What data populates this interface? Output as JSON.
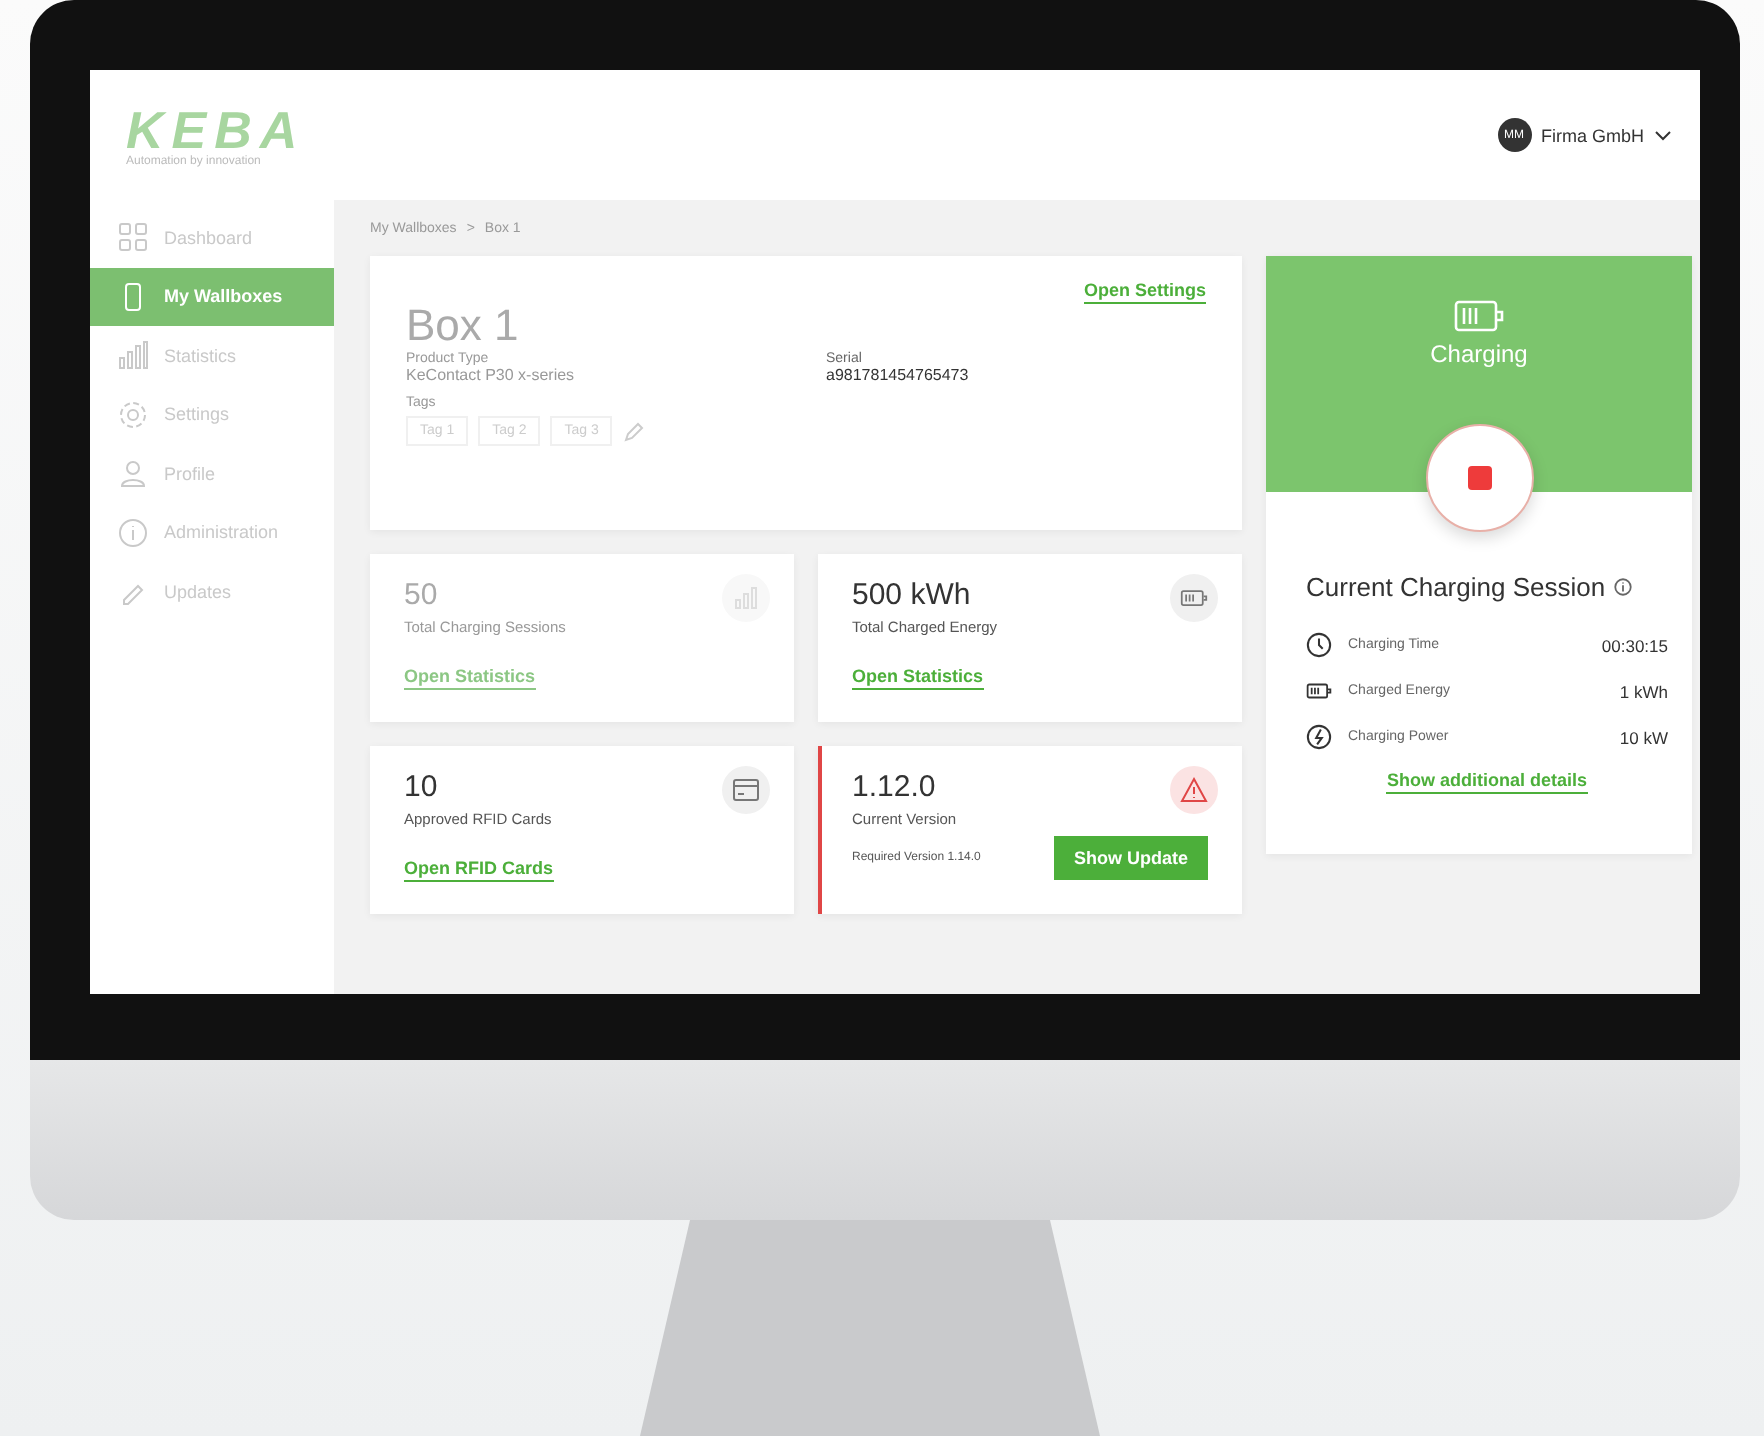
{
  "logo": {
    "name": "KEBA",
    "tagline": "Automation by innovation"
  },
  "user": {
    "initials": "MM",
    "name": "Firma GmbH"
  },
  "sidebar": {
    "items": [
      {
        "label": "Dashboard",
        "selected": false
      },
      {
        "label": "My Wallboxes",
        "selected": true
      },
      {
        "label": "Statistics",
        "selected": false
      },
      {
        "label": "Settings",
        "selected": false
      },
      {
        "label": "Profile",
        "selected": false
      },
      {
        "label": "Administration",
        "selected": false
      },
      {
        "label": "Updates",
        "selected": false
      }
    ]
  },
  "breadcrumb": {
    "items": [
      "My Wallboxes",
      "Box 1"
    ],
    "separator": ">"
  },
  "box": {
    "title": "Box 1",
    "link": "Open Settings",
    "product_type_label": "Product Type",
    "product_type": "KeContact P30 x-series",
    "serial_label": "Serial",
    "serial": "a981781454765473",
    "tags_label": "Tags",
    "tags": [
      "Tag 1",
      "Tag 2",
      "Tag 3"
    ]
  },
  "stat_cards": [
    {
      "kind": "chart",
      "value": "50",
      "label": "Total Charging Sessions",
      "link": "Open Statistics"
    },
    {
      "kind": "battery",
      "value": "500 kWh",
      "label": "Total Charged Energy",
      "link": "Open Statistics"
    },
    {
      "kind": "card",
      "value": "10",
      "label": "Approved RFID Cards",
      "link": "Open RFID Cards"
    },
    {
      "kind": "warning",
      "value": "1.12.0",
      "label": "Current Version",
      "note": "Required Version 1.14.0",
      "button": "Show Update"
    }
  ],
  "charging": {
    "status": "Charging",
    "title": "Current Charging Session",
    "rows": [
      {
        "kind": "clock",
        "label": "Charging Time",
        "value": "00:30:15"
      },
      {
        "kind": "battery",
        "label": "Charged Energy",
        "value": "1 kWh"
      },
      {
        "kind": "bolt",
        "label": "Charging Power",
        "value": "10 kW"
      }
    ],
    "link": "Show additional details"
  }
}
